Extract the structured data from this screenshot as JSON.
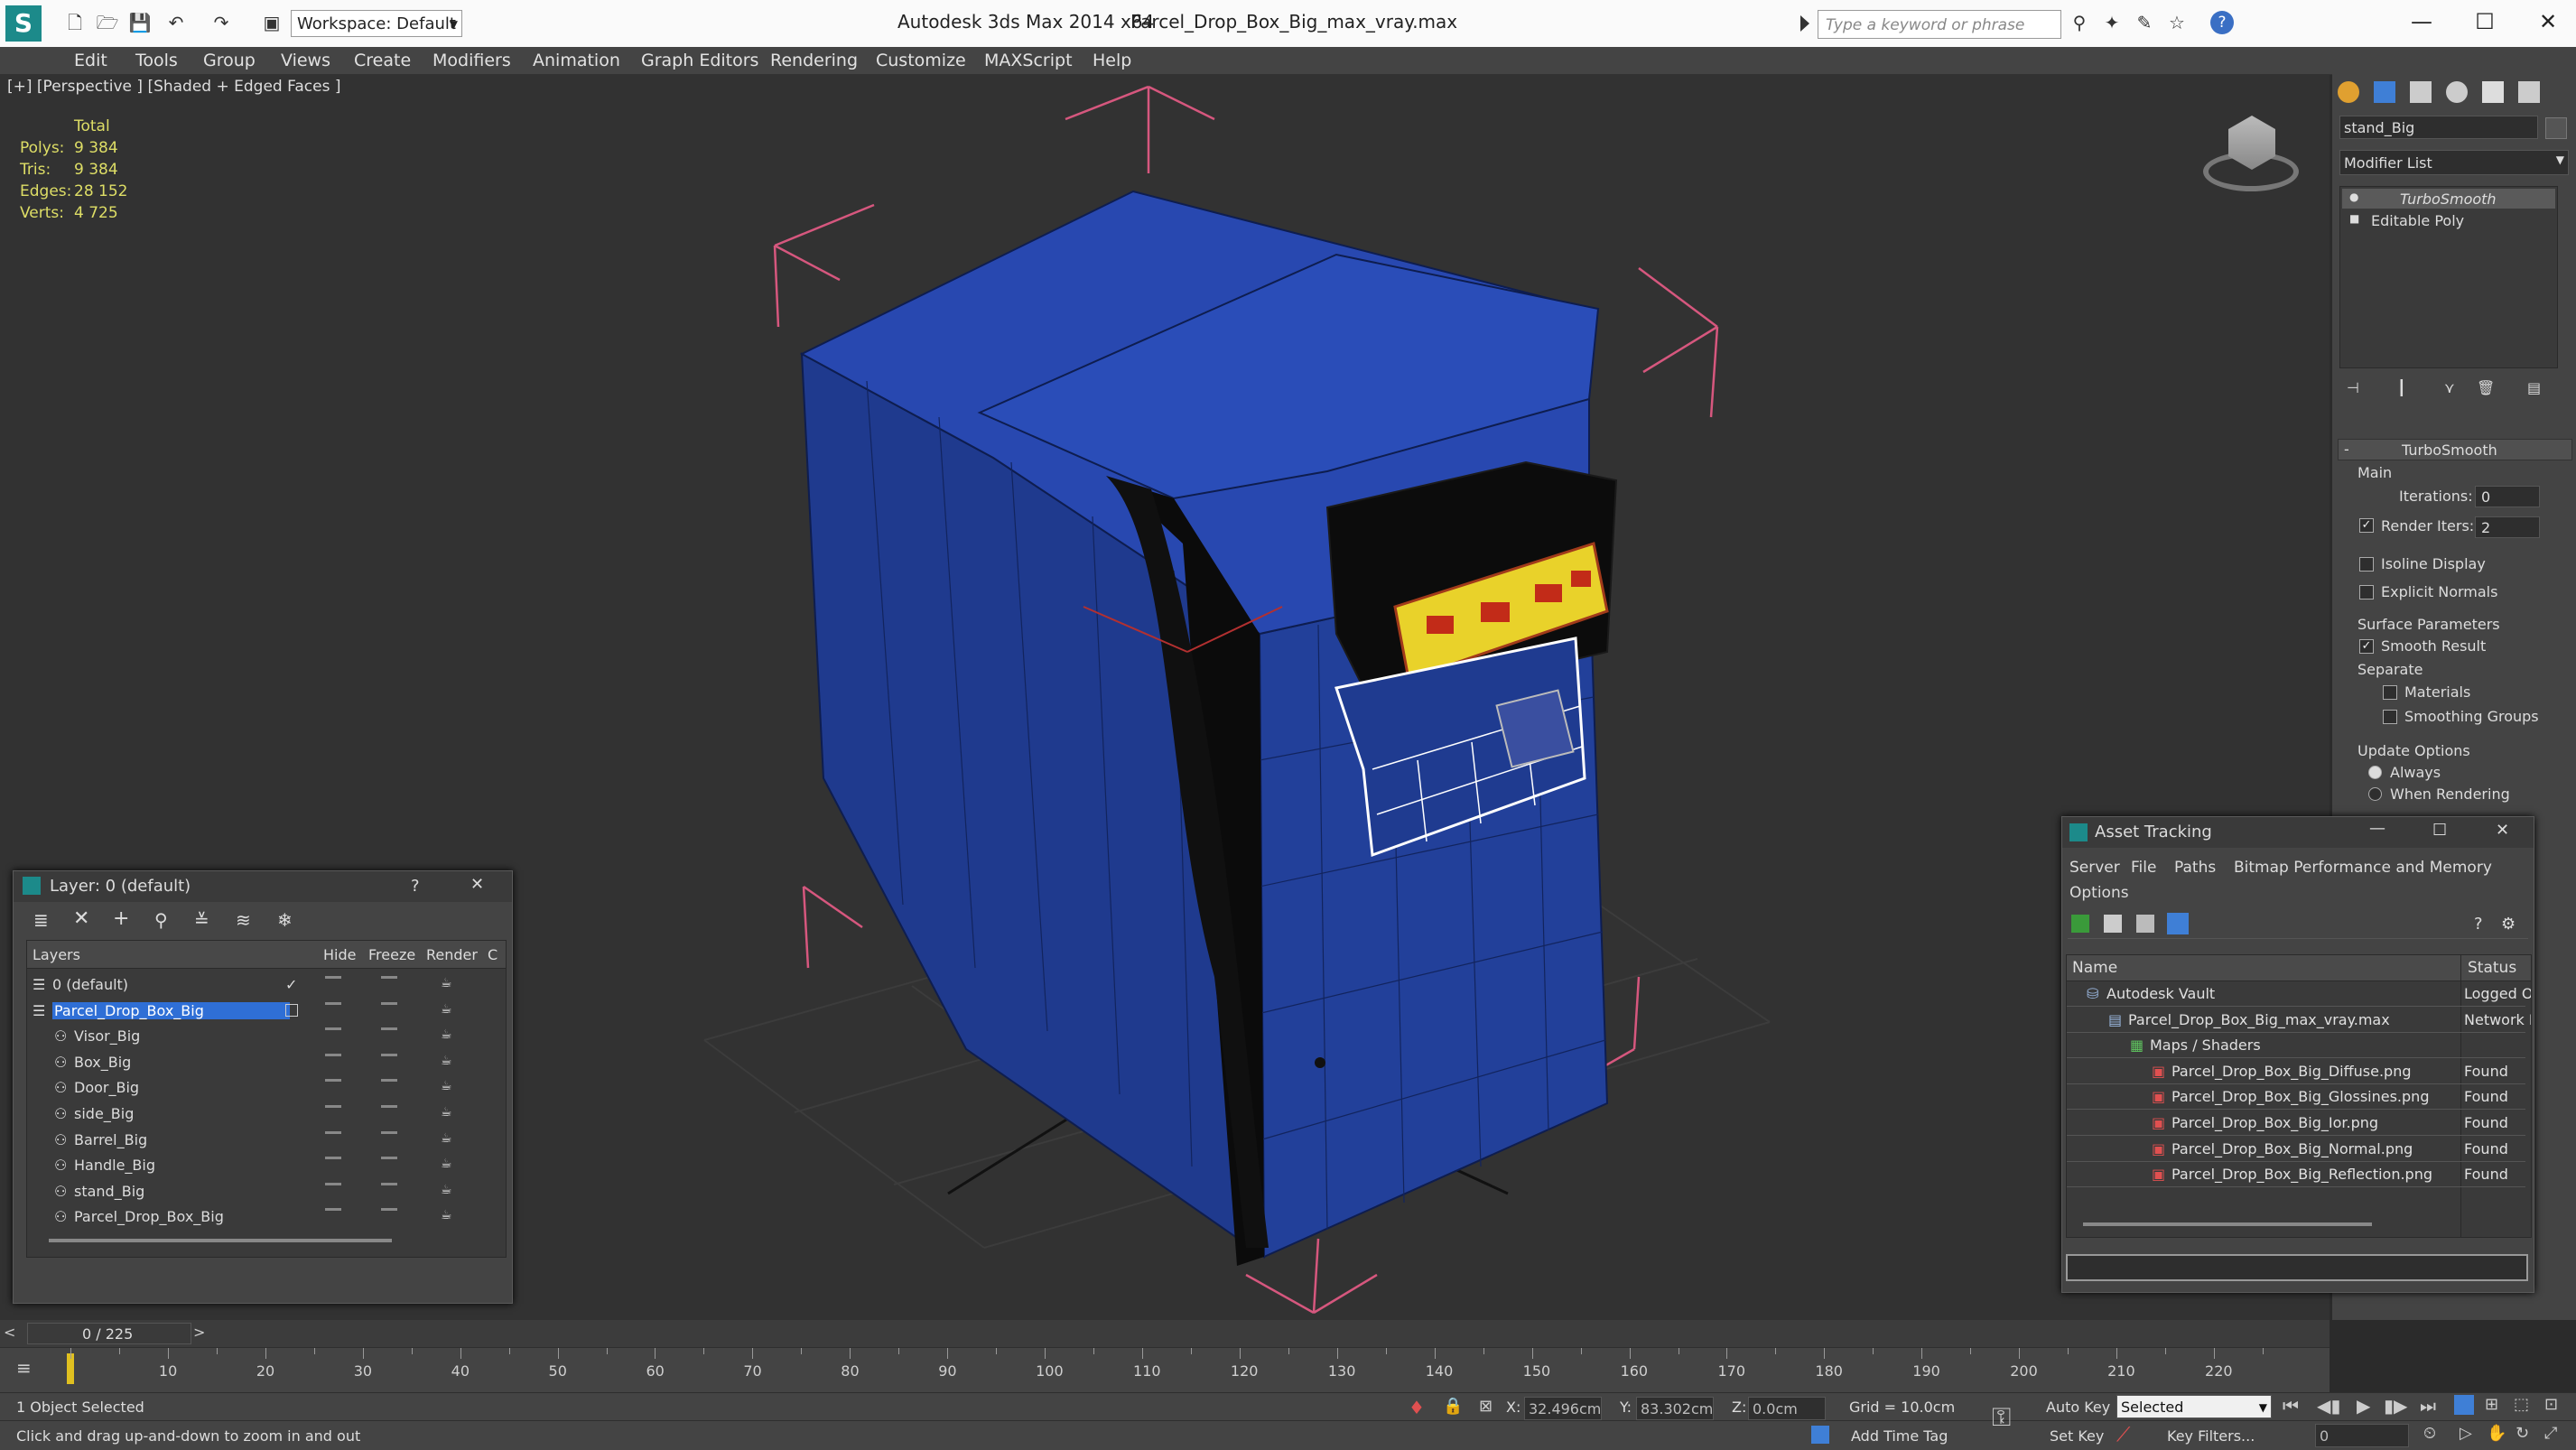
{
  "app": {
    "title": "Autodesk 3ds Max  2014 x64",
    "file": "Parcel_Drop_Box_Big_max_vray.max",
    "workspace_label": "Workspace: Default",
    "search_placeholder": "Type a keyword or phrase"
  },
  "menu": [
    "Edit",
    "Tools",
    "Group",
    "Views",
    "Create",
    "Modifiers",
    "Animation",
    "Graph Editors",
    "Rendering",
    "Customize",
    "MAXScript",
    "Help"
  ],
  "viewport": {
    "label": "[+] [Perspective ] [Shaded + Edged Faces ]",
    "stats": {
      "header": "Total",
      "rows": [
        {
          "label": "Polys:",
          "value": "9 384"
        },
        {
          "label": "Tris:",
          "value": "9 384"
        },
        {
          "label": "Edges:",
          "value": "28 152"
        },
        {
          "label": "Verts:",
          "value": "4 725"
        }
      ]
    }
  },
  "command_panel": {
    "object_name": "stand_Big",
    "modifier_list_label": "Modifier List",
    "stack": [
      "TurboSmooth",
      "Editable Poly"
    ],
    "rollout_title": "TurboSmooth",
    "main_label": "Main",
    "iterations_label": "Iterations:",
    "iterations_value": "0",
    "render_iters_label": "Render Iters:",
    "render_iters_value": "2",
    "isoline_label": "Isoline Display",
    "explicit_normals_label": "Explicit Normals",
    "surface_params_label": "Surface Parameters",
    "smooth_result_label": "Smooth Result",
    "separate_label": "Separate",
    "materials_label": "Materials",
    "smoothing_groups_label": "Smoothing Groups",
    "update_options_label": "Update Options",
    "always_label": "Always",
    "when_rendering_label": "When Rendering"
  },
  "layer_dialog": {
    "title": "Layer: 0 (default)",
    "help": "?",
    "columns": {
      "layers": "Layers",
      "hide": "Hide",
      "freeze": "Freeze",
      "render": "Render",
      "c": "C"
    },
    "rows": [
      {
        "name": "0 (default)",
        "level": 0,
        "selected": false,
        "current": true
      },
      {
        "name": "Parcel_Drop_Box_Big",
        "level": 0,
        "selected": true,
        "current": false
      },
      {
        "name": "Visor_Big",
        "level": 1,
        "selected": false,
        "current": false
      },
      {
        "name": "Box_Big",
        "level": 1,
        "selected": false,
        "current": false
      },
      {
        "name": "Door_Big",
        "level": 1,
        "selected": false,
        "current": false
      },
      {
        "name": "side_Big",
        "level": 1,
        "selected": false,
        "current": false
      },
      {
        "name": "Barrel_Big",
        "level": 1,
        "selected": false,
        "current": false
      },
      {
        "name": "Handle_Big",
        "level": 1,
        "selected": false,
        "current": false
      },
      {
        "name": "stand_Big",
        "level": 1,
        "selected": false,
        "current": false
      },
      {
        "name": "Parcel_Drop_Box_Big",
        "level": 1,
        "selected": false,
        "current": false
      }
    ]
  },
  "asset_dialog": {
    "title": "Asset Tracking",
    "menu": [
      "Server",
      "File",
      "Paths",
      "Bitmap Performance and Memory"
    ],
    "menu2": "Options",
    "col_name": "Name",
    "col_status": "Status",
    "rows": [
      {
        "name": "Autodesk Vault",
        "status": "Logged O",
        "level": 1
      },
      {
        "name": "Parcel_Drop_Box_Big_max_vray.max",
        "status": "Network I",
        "level": 2
      },
      {
        "name": "Maps / Shaders",
        "status": "",
        "level": 3
      },
      {
        "name": "Parcel_Drop_Box_Big_Diffuse.png",
        "status": "Found",
        "level": 4
      },
      {
        "name": "Parcel_Drop_Box_Big_Glossines.png",
        "status": "Found",
        "level": 4
      },
      {
        "name": "Parcel_Drop_Box_Big_Ior.png",
        "status": "Found",
        "level": 4
      },
      {
        "name": "Parcel_Drop_Box_Big_Normal.png",
        "status": "Found",
        "level": 4
      },
      {
        "name": "Parcel_Drop_Box_Big_Reflection.png",
        "status": "Found",
        "level": 4
      }
    ]
  },
  "timeline": {
    "frame_counter": "0 / 225",
    "ticks": [
      "10",
      "20",
      "30",
      "40",
      "50",
      "60",
      "70",
      "80",
      "90",
      "100",
      "110",
      "120",
      "130",
      "140",
      "150",
      "160",
      "170",
      "180",
      "190",
      "200",
      "210",
      "220"
    ]
  },
  "status": {
    "selection": "1 Object Selected",
    "prompt": "Click and drag up-and-down to zoom in and out",
    "x_label": "X:",
    "x_value": "32.496cm",
    "y_label": "Y:",
    "y_value": "83.302cm",
    "z_label": "Z:",
    "z_value": "0.0cm",
    "grid": "Grid = 10.0cm",
    "add_time_tag": "Add Time Tag",
    "auto_key": "Auto Key",
    "set_key": "Set Key",
    "selected_value": "Selected",
    "key_filters": "Key Filters...",
    "frame_value": "0"
  },
  "colors": {
    "accent_blue": "#2f6fd6",
    "box_blue": "#1f3f97",
    "wire_pink": "#d6577e",
    "stat_yellow": "#dede66"
  }
}
